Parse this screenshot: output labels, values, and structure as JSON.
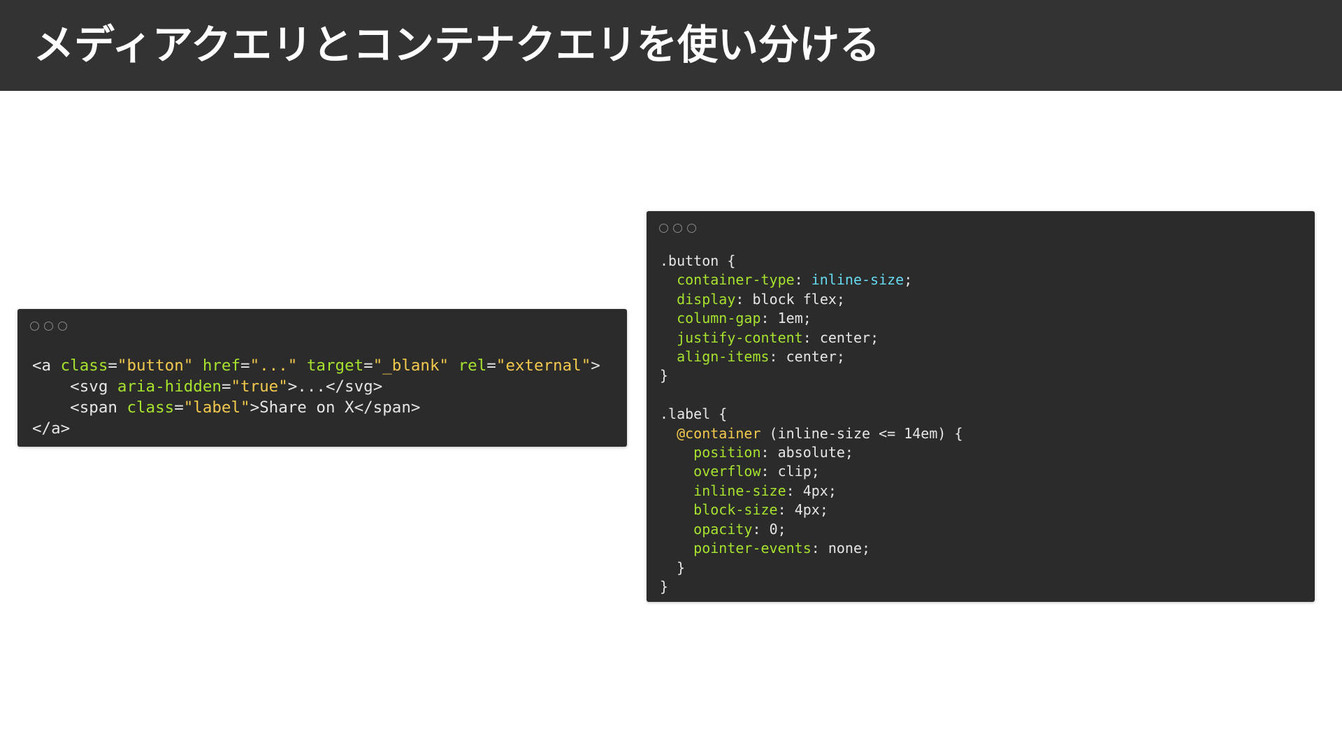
{
  "title": "メディアクエリとコンテナクエリを使い分ける",
  "html_code": {
    "l1": {
      "open": "<a ",
      "a1_name": "class",
      "eq1": "=",
      "a1_val": "\"button\"",
      "sp1": " ",
      "a2_name": "href",
      "eq2": "=",
      "a2_val": "\"...\"",
      "sp2": " ",
      "a3_name": "target",
      "eq3": "=",
      "a3_val": "\"_blank\"",
      "sp3": " ",
      "a4_name": "rel",
      "eq4": "=",
      "a4_val": "\"external\"",
      "close": ">"
    },
    "l2": {
      "open": "    <svg ",
      "a1_name": "aria-hidden",
      "eq1": "=",
      "a1_val": "\"true\"",
      "rest": ">...</svg>"
    },
    "l3": {
      "open": "    <span ",
      "a1_name": "class",
      "eq1": "=",
      "a1_val": "\"label\"",
      "gt": ">",
      "text": "Share on X",
      "close": "</span>"
    },
    "l4": {
      "close": "</a>"
    }
  },
  "css_code": {
    "b1_sel": ".button {",
    "b1_p1": "container-type",
    "b1_v1": "inline-size",
    "b1_p2": "display",
    "b1_v2": "block flex",
    "b1_p3": "column-gap",
    "b1_v3": "1em",
    "b1_p4": "justify-content",
    "b1_v4": "center",
    "b1_p5": "align-items",
    "b1_v5": "center",
    "b1_close": "}",
    "b2_sel": ".label {",
    "at_kw": "@container",
    "at_cond": " (inline-size <= 14em) {",
    "b2_p1": "position",
    "b2_v1": "absolute",
    "b2_p2": "overflow",
    "b2_v2": "clip",
    "b2_p3": "inline-size",
    "b2_v3": "4px",
    "b2_p4": "block-size",
    "b2_v4": "4px",
    "b2_p5": "opacity",
    "b2_v5": "0",
    "b2_p6": "pointer-events",
    "b2_v6": "none",
    "at_close": "  }",
    "b2_close": "}"
  },
  "colors": {
    "header_bg": "#333333",
    "code_bg": "#2b2b2b",
    "attr_green": "#a6e22e",
    "string_yellow": "#f2c94c",
    "keyword_cyan": "#66d9ef"
  }
}
